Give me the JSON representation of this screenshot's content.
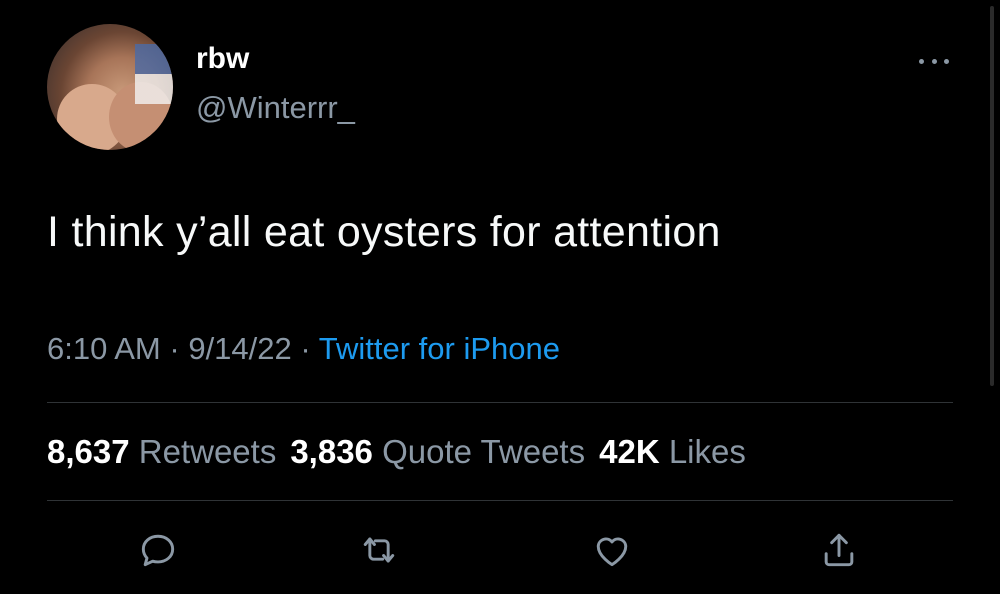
{
  "tweet": {
    "name": "rbw",
    "handle": "@Winterrr_",
    "text": "I think y’all eat oysters for attention",
    "time": "6:10 AM",
    "date": "9/14/22",
    "source": "Twitter for iPhone",
    "separator": "·"
  },
  "stats": {
    "retweets": "8,637",
    "retweets_label": "Retweets",
    "quotes": "3,836",
    "quotes_label": "Quote Tweets",
    "likes": "42K",
    "likes_label": "Likes"
  },
  "icons": {
    "more": "more-icon",
    "reply": "reply-icon",
    "retweet": "retweet-icon",
    "like": "like-icon",
    "share": "share-icon"
  },
  "colors": {
    "background": "#000000",
    "link": "#1d9bf0",
    "muted": "#8b98a5"
  }
}
